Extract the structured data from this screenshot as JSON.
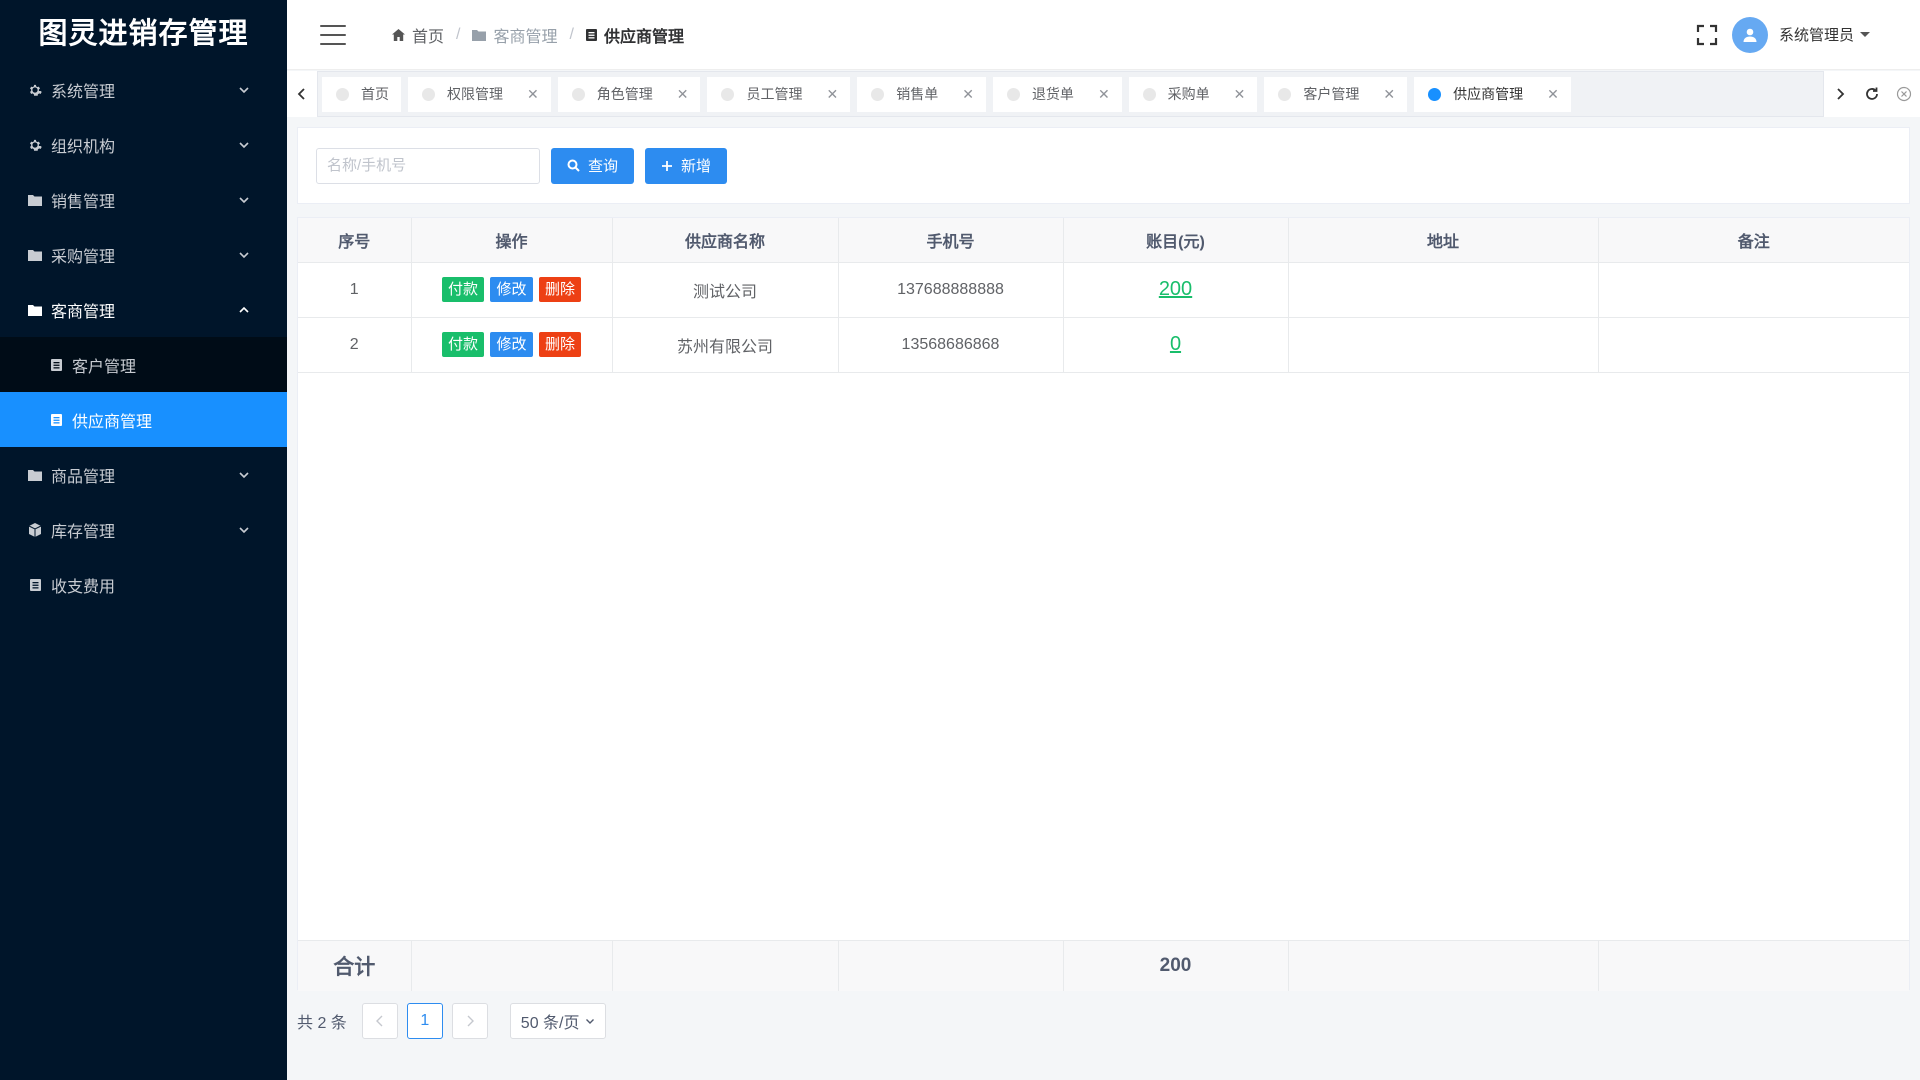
{
  "app": {
    "title": "图灵进销存管理"
  },
  "sidebar": {
    "items": [
      {
        "label": "系统管理",
        "icon": "gear-icon"
      },
      {
        "label": "组织机构",
        "icon": "gear-icon"
      },
      {
        "label": "销售管理",
        "icon": "folder-icon"
      },
      {
        "label": "采购管理",
        "icon": "folder-icon"
      },
      {
        "label": "客商管理",
        "icon": "folder-icon",
        "expanded": true
      },
      {
        "label": "商品管理",
        "icon": "folder-icon"
      },
      {
        "label": "库存管理",
        "icon": "cube-icon"
      },
      {
        "label": "收支费用",
        "icon": "document-icon"
      }
    ],
    "submenu": [
      {
        "label": "客户管理",
        "icon": "document-icon"
      },
      {
        "label": "供应商管理",
        "icon": "document-icon",
        "active": true
      }
    ]
  },
  "header": {
    "breadcrumb": [
      "首页",
      "客商管理",
      "供应商管理"
    ],
    "user": "系统管理员"
  },
  "tabs": [
    {
      "label": "首页",
      "closable": false
    },
    {
      "label": "权限管理",
      "closable": true
    },
    {
      "label": "角色管理",
      "closable": true
    },
    {
      "label": "员工管理",
      "closable": true
    },
    {
      "label": "销售单",
      "closable": true
    },
    {
      "label": "退货单",
      "closable": true
    },
    {
      "label": "采购单",
      "closable": true
    },
    {
      "label": "客户管理",
      "closable": true
    },
    {
      "label": "供应商管理",
      "closable": true,
      "active": true
    }
  ],
  "search": {
    "placeholder": "名称/手机号",
    "value": "",
    "query_label": "查询",
    "add_label": "新增"
  },
  "table": {
    "columns": [
      "序号",
      "操作",
      "供应商名称",
      "手机号",
      "账目(元)",
      "地址",
      "备注"
    ],
    "actions": {
      "pay": "付款",
      "edit": "修改",
      "delete": "删除"
    },
    "rows": [
      {
        "index": "1",
        "name": "测试公司",
        "phone": "137688888888",
        "amount": "200",
        "address": "",
        "remark": ""
      },
      {
        "index": "2",
        "name": "苏州有限公司",
        "phone": "13568686868",
        "amount": "0",
        "address": "",
        "remark": ""
      }
    ],
    "footer": {
      "label": "合计",
      "total": "200"
    }
  },
  "pagination": {
    "total_text": "共 2 条",
    "current_page": "1",
    "page_size": "50 条/页"
  },
  "colors": {
    "sidebar_bg": "#00152a",
    "active": "#1890ff",
    "pay": "#19be6b",
    "edit": "#2d8cf0",
    "delete": "#ed4014"
  }
}
